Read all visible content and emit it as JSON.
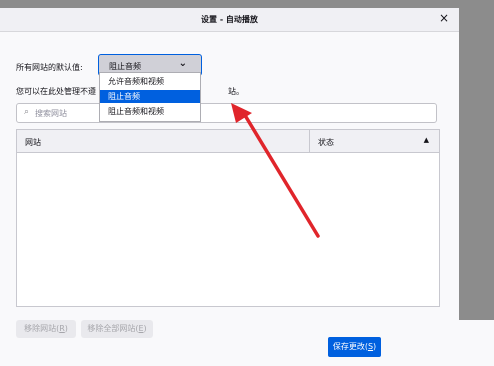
{
  "dialog": {
    "title": "设置 - 自动播放",
    "close_icon": "close-icon"
  },
  "default_setting": {
    "label": "所有网站的默认值:",
    "selected": "阻止音频",
    "chevron_icon": "chevron-down-icon",
    "options": [
      "允许音频和视频",
      "阻止音频",
      "阻止音频和视频"
    ]
  },
  "description": {
    "visible_left": "您可以在此处管理不遵",
    "visible_right": "站。"
  },
  "search": {
    "placeholder": "搜索网站",
    "icon": "search-icon"
  },
  "table": {
    "columns": [
      "网站",
      "状态"
    ],
    "sort_indicator": "▲",
    "rows": []
  },
  "buttons": {
    "remove": "移除网站",
    "remove_key": "R",
    "remove_all": "移除全部网站",
    "remove_all_key": "E",
    "save": "保存更改",
    "save_key": "S"
  },
  "annotation": {
    "arrow_color": "#e0252b"
  },
  "colors": {
    "accent": "#0060df"
  }
}
